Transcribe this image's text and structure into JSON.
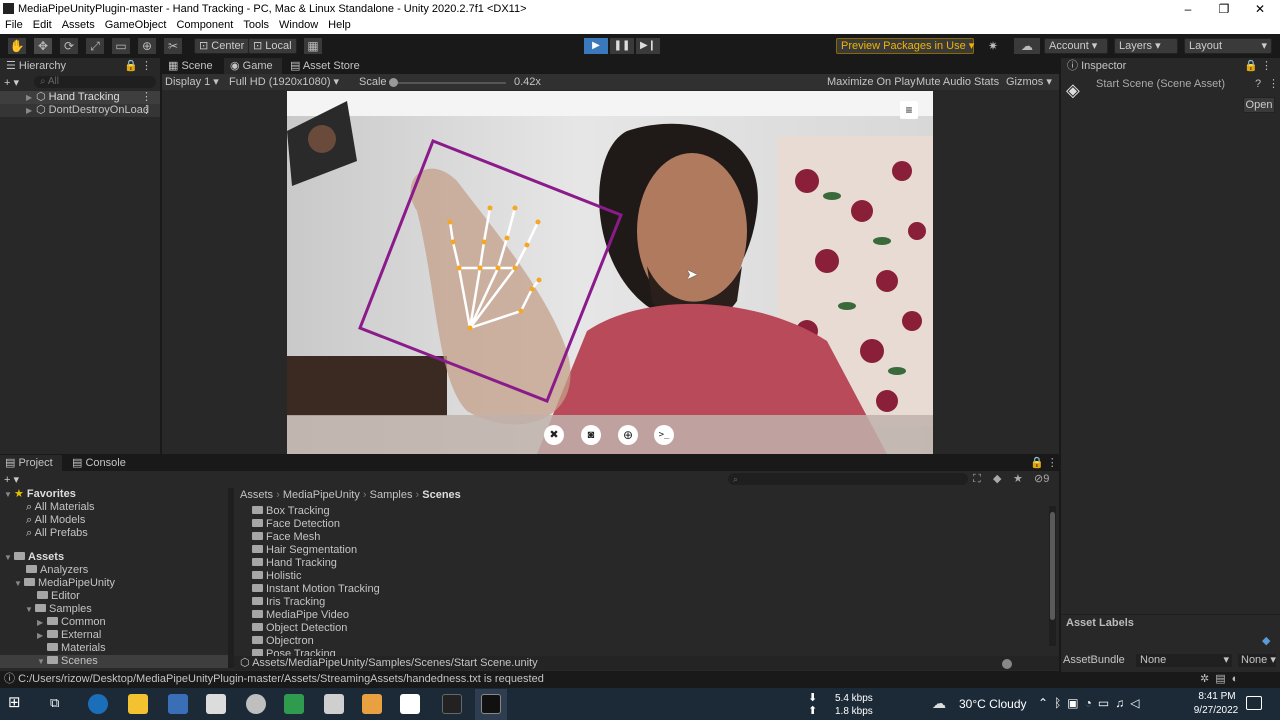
{
  "window": {
    "title": "MediaPipeUnityPlugin-master - Hand Tracking - PC, Mac & Linux Standalone - Unity 2020.2.7f1 <DX11>"
  },
  "menu": [
    "File",
    "Edit",
    "Assets",
    "GameObject",
    "Component",
    "Tools",
    "Window",
    "Help"
  ],
  "toolbar": {
    "pivot": "Center",
    "space": "Local",
    "preview_packages": "Preview Packages in Use",
    "account": "Account",
    "layers": "Layers",
    "layout": "Layout"
  },
  "hierarchy": {
    "title": "Hierarchy",
    "search_placeholder": "All",
    "items": [
      "Hand Tracking",
      "DontDestroyOnLoad"
    ]
  },
  "game": {
    "tabs": [
      "Scene",
      "Game",
      "Asset Store"
    ],
    "display": "Display 1",
    "resolution": "Full HD (1920x1080)",
    "scale_label": "Scale",
    "scale_value": "0.42x",
    "scale_level": 0.0,
    "maximize": "Maximize On Play",
    "mute": "Mute Audio",
    "stats": "Stats",
    "gizmos": "Gizmos"
  },
  "inspector": {
    "title": "Inspector",
    "asset": "Start Scene (Scene Asset)",
    "open": "Open",
    "asset_labels": "Asset Labels",
    "asset_bundle_label": "AssetBundle",
    "asset_bundle_value": "None",
    "asset_bundle_variant": "None"
  },
  "project": {
    "tabs": [
      "Project",
      "Console"
    ],
    "hidden_count": "9",
    "favorites": {
      "title": "Favorites",
      "items": [
        "All Materials",
        "All Models",
        "All Prefabs"
      ]
    },
    "tree": {
      "root": "Assets",
      "items": [
        "Analyzers",
        "MediaPipeUnity",
        "Editor",
        "Samples",
        "Common",
        "External",
        "Materials",
        "Scenes"
      ]
    },
    "breadcrumb": [
      "Assets",
      "MediaPipeUnity",
      "Samples",
      "Scenes"
    ],
    "folders": [
      "Box Tracking",
      "Face Detection",
      "Face Mesh",
      "Hair Segmentation",
      "Hand Tracking",
      "Holistic",
      "Instant Motion Tracking",
      "Iris Tracking",
      "MediaPipe Video",
      "Object Detection",
      "Objectron",
      "Pose Tracking"
    ],
    "selected_path": "Assets/MediaPipeUnity/Samples/Scenes/Start Scene.unity"
  },
  "status": {
    "message": "C:/Users/rizow/Desktop/MediaPipeUnityPlugin-master/Assets/StreamingAssets/handedness.txt is requested"
  },
  "taskbar": {
    "download": "5.4 kbps",
    "upload": "1.8 kbps",
    "weather": "30°C  Cloudy",
    "time": "8:41 PM",
    "date": "9/27/2022"
  },
  "colors": {
    "accent_blue": "#3a79bb",
    "play_active": "#4a90d9",
    "preview_packages": "#e0a000",
    "bounding_box": "#8b1a8b",
    "landmark": "#f5a623"
  }
}
